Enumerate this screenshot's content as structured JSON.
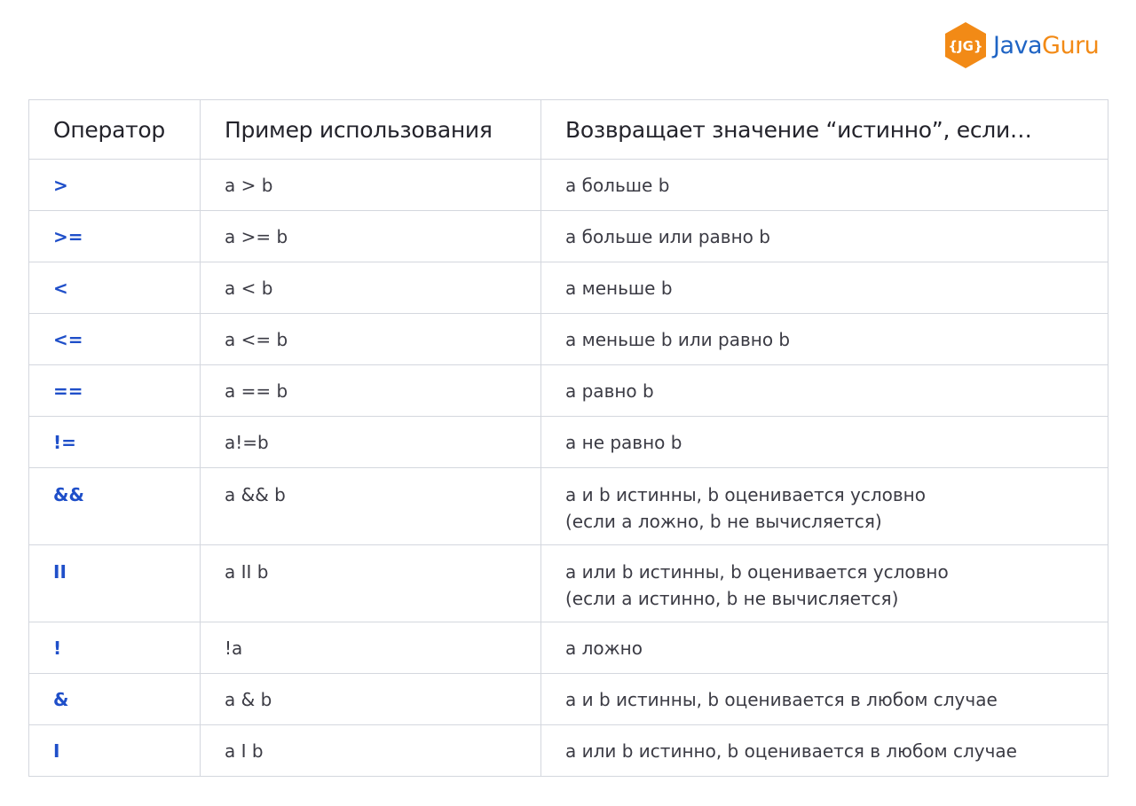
{
  "logo": {
    "badge": "{JG}",
    "brand_part1": "Java",
    "brand_part2": "Guru",
    "colors": {
      "badge": "#f28a16",
      "java": "#1f64c4",
      "guru": "#f28a16"
    }
  },
  "table": {
    "headers": [
      "Оператор",
      "Пример использования",
      "Возвращает значение “истинно”, если…"
    ],
    "rows": [
      {
        "operator": ">",
        "example": "a > b",
        "result": [
          "а больше b"
        ]
      },
      {
        "operator": ">=",
        "example": "a >= b",
        "result": [
          "а больше или равно b"
        ]
      },
      {
        "operator": "<",
        "example": "a < b",
        "result": [
          "а меньше b"
        ]
      },
      {
        "operator": "<=",
        "example": "a <= b",
        "result": [
          "а меньше b или равно b"
        ]
      },
      {
        "operator": "==",
        "example": "a == b",
        "result": [
          "а равно b"
        ]
      },
      {
        "operator": "!=",
        "example": "a!=b",
        "result": [
          "а не равно b"
        ]
      },
      {
        "operator": "&&",
        "example": "a && b",
        "result": [
          "а и b истинны, b оценивается условно",
          "(если а ложно, b не вычисляется)"
        ]
      },
      {
        "operator": "II",
        "example": "a II b",
        "result": [
          "а или b истинны, b оценивается условно",
          "(если а истинно, b не вычисляется)"
        ]
      },
      {
        "operator": "!",
        "example": "!a",
        "result": [
          "а ложно"
        ]
      },
      {
        "operator": "&",
        "example": "a & b",
        "result": [
          "а и b истинны, b оценивается в любом случае"
        ]
      },
      {
        "operator": "I",
        "example": "a I b",
        "result": [
          "а или b истинно, b оценивается в любом случае"
        ]
      }
    ],
    "colors": {
      "operator": "#1f4fc9",
      "border": "#d4d7de"
    }
  }
}
